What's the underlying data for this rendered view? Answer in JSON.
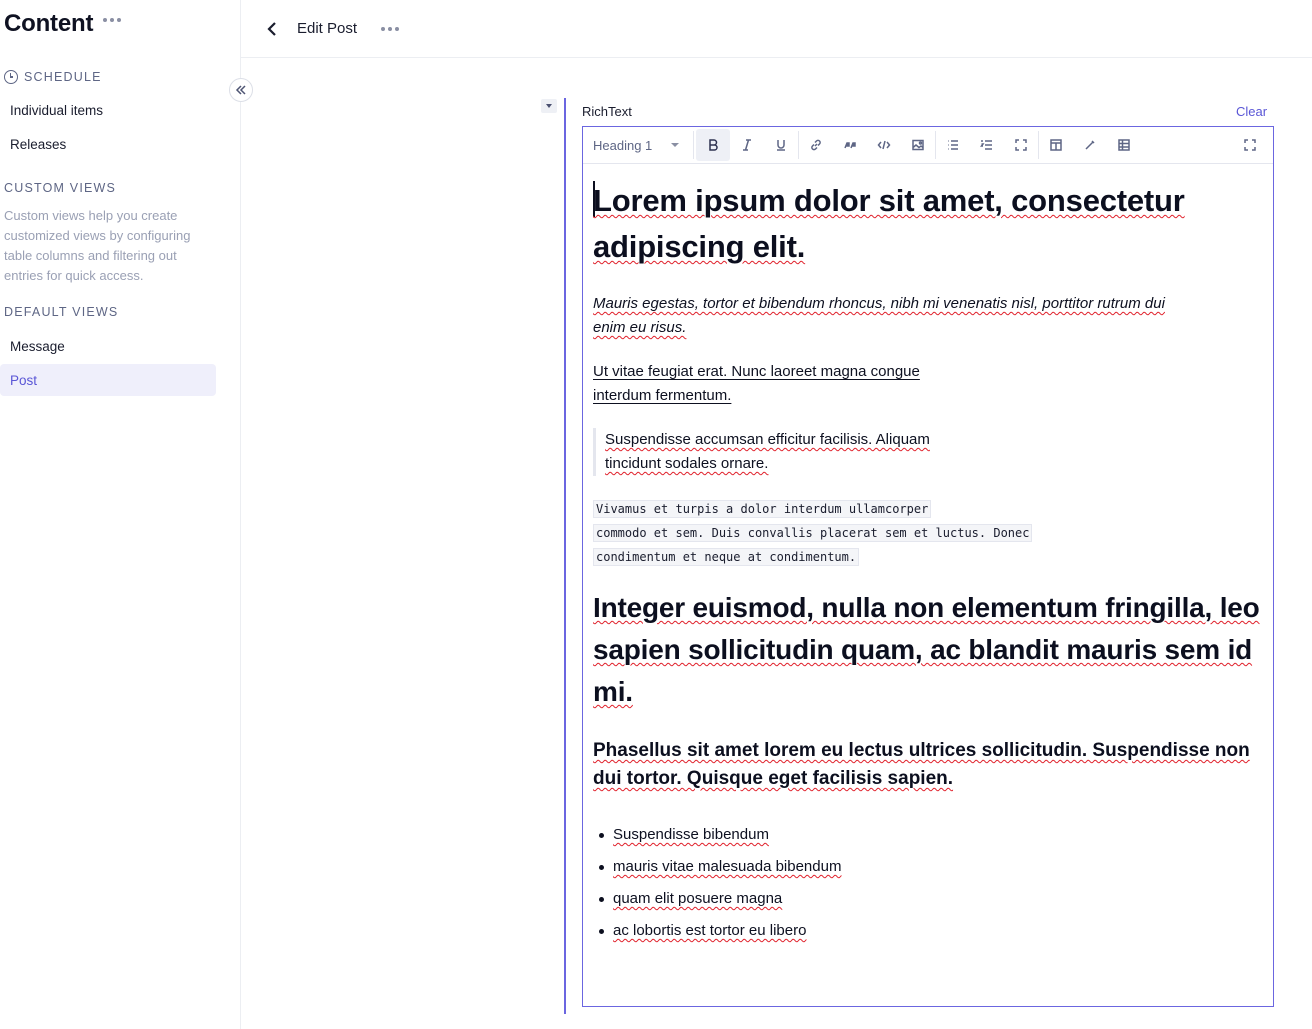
{
  "sidebar": {
    "title": "Content",
    "schedule_label": "SCHEDULE",
    "schedule_items": [
      {
        "label": "Individual items"
      },
      {
        "label": "Releases"
      }
    ],
    "custom_views_label": "CUSTOM VIEWS",
    "custom_views_help": "Custom views help you create customized views by configuring table columns and filtering out entries for quick access.",
    "default_views_label": "DEFAULT VIEWS",
    "default_views_items": [
      {
        "label": "Message"
      },
      {
        "label": "Post"
      }
    ],
    "active_item": "Post"
  },
  "topbar": {
    "title": "Edit Post"
  },
  "field": {
    "label": "RichText",
    "clear_label": "Clear"
  },
  "toolbar": {
    "block_type": "Heading 1",
    "buttons": [
      "bold-icon",
      "italic-icon",
      "underline-icon",
      "link-icon",
      "quote-icon",
      "code-icon",
      "image-icon",
      "bulleted-list-icon",
      "numbered-list-icon",
      "embed-icon",
      "layout-icon",
      "pen-icon",
      "table-icon",
      "fullscreen-icon"
    ]
  },
  "content": {
    "h1": "Lorem ipsum dolor sit amet, consectetur adipiscing elit.",
    "italic_paragraph": "Mauris egestas, tortor et bibendum rhoncus, nibh mi venenatis nisl, porttitor rutrum dui enim eu risus.",
    "underline_paragraph": "Ut vitae feugiat erat. Nunc laoreet magna congue interdum fermentum.",
    "quote": "Suspendisse accumsan efficitur facilisis. Aliquam tincidunt sodales ornare.",
    "code_lines": [
      "Vivamus et turpis a dolor interdum ullamcorper",
      " commodo et sem. Duis convallis placerat sem et luctus. Donec ",
      "condimentum et neque at condimentum."
    ],
    "h2": "Integer euismod, nulla non elementum fringilla, leo sapien sollicitudin quam, ac blandit mauris sem id mi.",
    "bold_paragraph": "Phasellus sit amet lorem eu lectus ultrices sollicitudin. Suspendisse non dui tortor. Quisque eget facilisis sapien.",
    "bullets": [
      "Suspendisse bibendum",
      "mauris vitae malesuada bibendum",
      "quam elit posuere magna",
      "ac lobortis est tortor eu libero"
    ]
  },
  "colors": {
    "accent": "#6b66e0",
    "active_bg": "#efeffb",
    "spellcheck": "#e0202a"
  }
}
